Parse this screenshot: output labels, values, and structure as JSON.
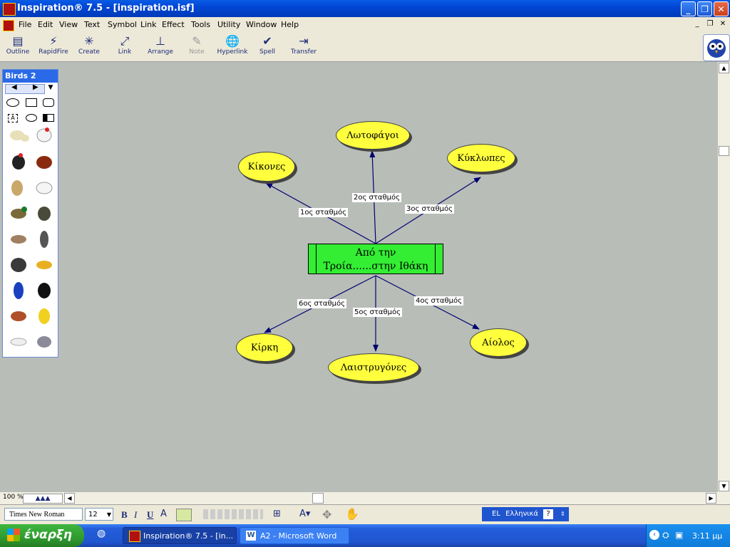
{
  "window": {
    "title": "Inspiration® 7.5 - [inspiration.isf]"
  },
  "menu": [
    "File",
    "Edit",
    "View",
    "Text",
    "Symbol",
    "Link",
    "Effect",
    "Tools",
    "Utility",
    "Window",
    "Help"
  ],
  "toolbar": [
    {
      "label": "Outline",
      "icon": "outline-icon"
    },
    {
      "label": "RapidFire",
      "icon": "rapidfire-icon"
    },
    {
      "label": "Create",
      "icon": "create-icon"
    },
    {
      "label": "Link",
      "icon": "link-icon"
    },
    {
      "label": "Arrange",
      "icon": "arrange-icon"
    },
    {
      "label": "Note",
      "icon": "note-icon",
      "disabled": true
    },
    {
      "label": "Hyperlink",
      "icon": "hyperlink-icon"
    },
    {
      "label": "Spell",
      "icon": "spell-icon"
    },
    {
      "label": "Transfer",
      "icon": "transfer-icon"
    }
  ],
  "palette": {
    "title": "Birds 2"
  },
  "diagram": {
    "main": {
      "line1": "Από  την",
      "line2": "Τροία......στην Ιθάκη",
      "color": "#33ee33"
    },
    "nodes": [
      {
        "id": "kikones",
        "label": "Κίκονες",
        "link": "1ος σταθμός"
      },
      {
        "id": "lotofagoi",
        "label": "Λωτοφάγοι",
        "link": "2ος σταθμός"
      },
      {
        "id": "kyklopes",
        "label": "Κύκλωπες",
        "link": "3ος σταθμός"
      },
      {
        "id": "aiolos",
        "label": "Αίολος",
        "link": "4ος σταθμός"
      },
      {
        "id": "laistrygones",
        "label": "Λαιστρυγόνες",
        "link": "5ος σταθμός"
      },
      {
        "id": "kirki",
        "label": "Κίρκη",
        "link": "6ος σταθμός"
      }
    ],
    "node_color": "#ffff3d",
    "link_color": "#00006e"
  },
  "statusbar": {
    "zoom": "100 %"
  },
  "format": {
    "font": "Times New Roman",
    "size": "12",
    "bold": "B",
    "italic": "I",
    "underline": "U"
  },
  "language": {
    "code": "EL",
    "name": "Ελληνικά"
  },
  "taskbar": {
    "start": "έναρξη",
    "tasks": [
      "Inspiration® 7.5 - [in...",
      "A2 - Microsoft Word"
    ],
    "clock": "3:11 μμ"
  }
}
